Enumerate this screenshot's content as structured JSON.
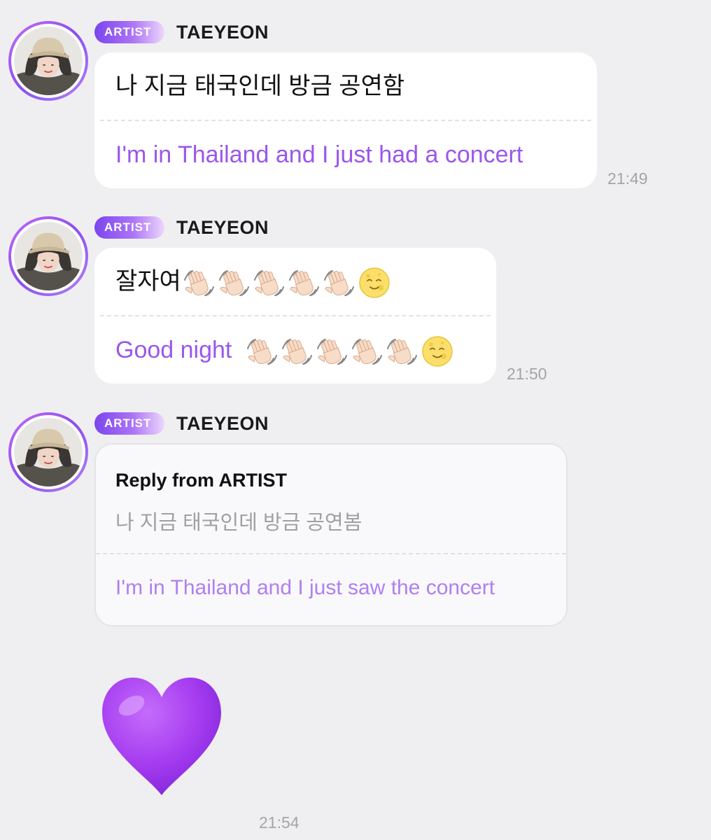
{
  "messages": [
    {
      "badge": "ARTIST",
      "sender": "TAEYEON",
      "original": "나 지금 태국인데 방금 공연함",
      "translation": "I'm in Thailand and I just had a concert",
      "time": "21:49"
    },
    {
      "badge": "ARTIST",
      "sender": "TAEYEON",
      "original": "잘자여",
      "translation": "Good night",
      "emoji": [
        "waving-hand",
        "waving-hand",
        "waving-hand",
        "waving-hand",
        "waving-hand",
        "full-moon-face"
      ],
      "time": "21:50"
    },
    {
      "badge": "ARTIST",
      "sender": "TAEYEON",
      "reply_title": "Reply from ARTIST",
      "reply_original": "나 지금 태국인데 방금 공연봄",
      "reply_translation": "I'm in Thailand and I just saw the concert"
    }
  ],
  "heart_message": {
    "emoji": "purple-heart",
    "time": "21:54"
  },
  "colors": {
    "background": "#efeff1",
    "translation_text": "#9a57eb",
    "badge_gradient_start": "#7b45ee",
    "timestamp": "#a5a5a5",
    "heart": "#a53cf0"
  }
}
